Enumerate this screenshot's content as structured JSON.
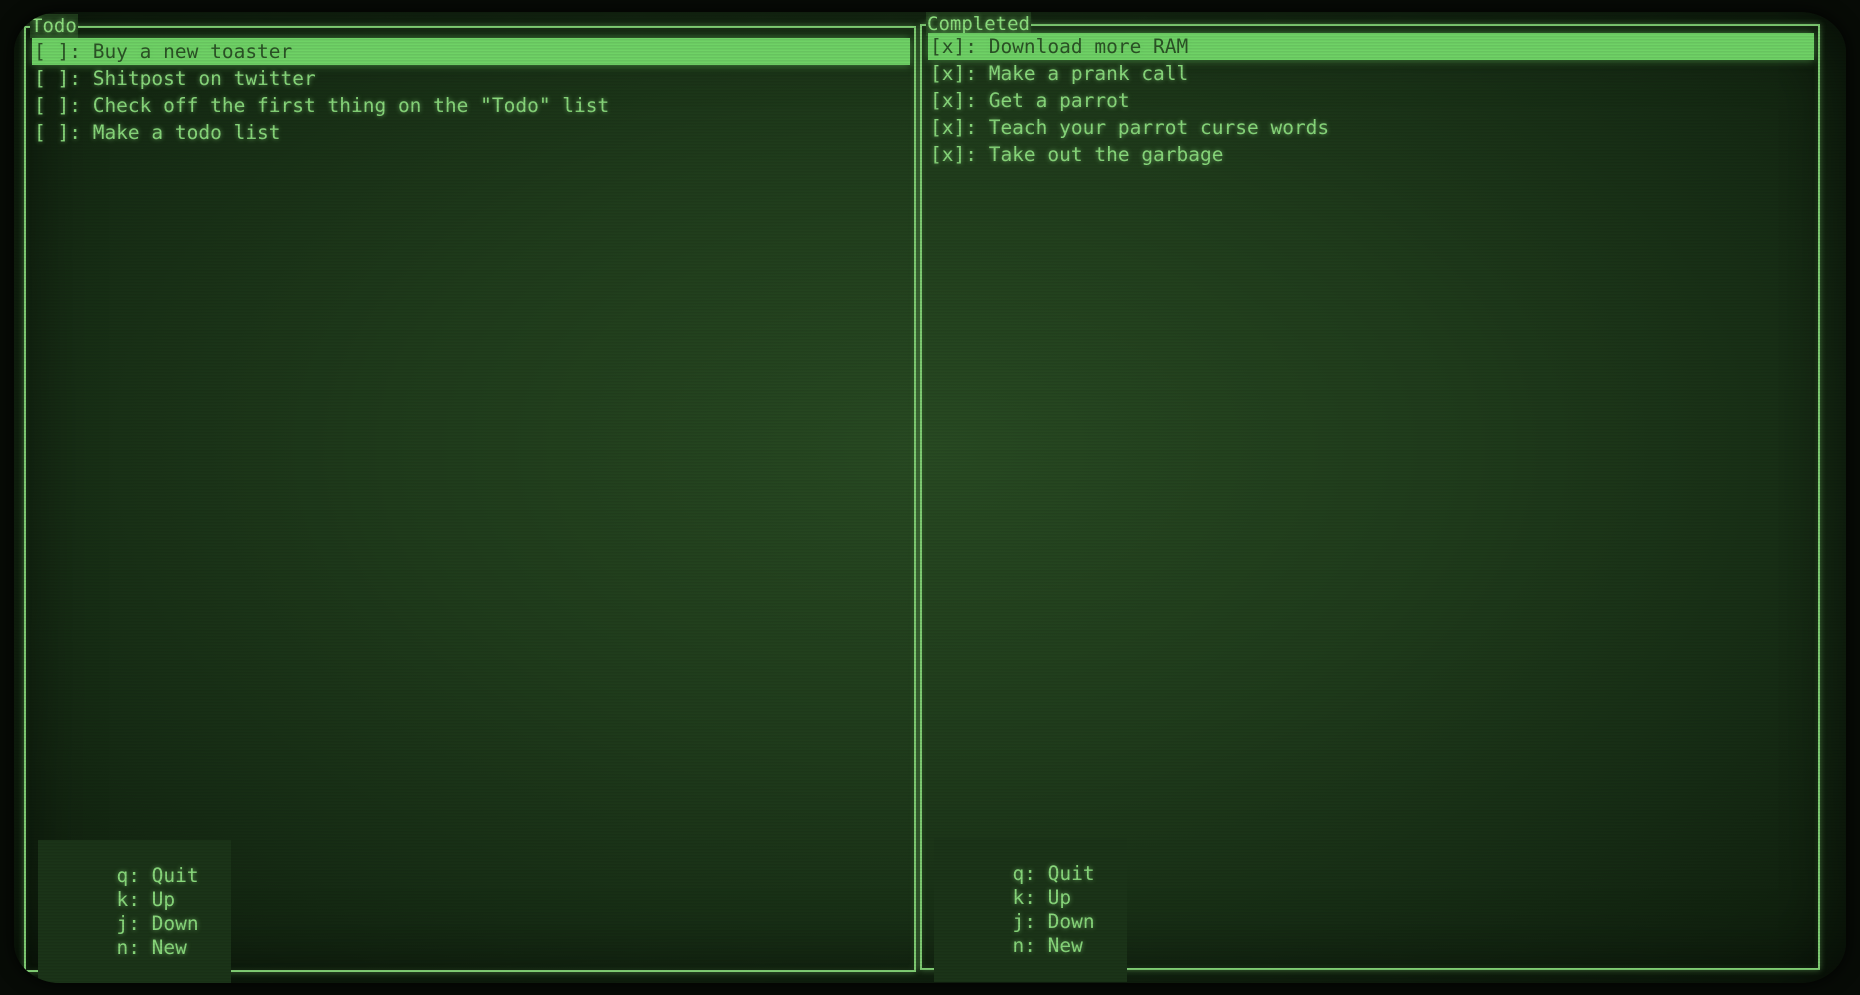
{
  "colors": {
    "background": "#1f3b1b",
    "foreground": "#88d87b",
    "highlight": "#6fd266",
    "highlight_text": "#2b5326"
  },
  "todo": {
    "title": "Todo",
    "items": [
      {
        "text": "[ ]: Buy a new toaster",
        "selected": true
      },
      {
        "text": "[ ]: Shitpost on twitter",
        "selected": false
      },
      {
        "text": "[ ]: Check off the first thing on the \"Todo\" list",
        "selected": false
      },
      {
        "text": "[ ]: Make a todo list",
        "selected": false
      }
    ],
    "footer": {
      "quit": "q: Quit",
      "up": "k: Up",
      "down": "j: Down",
      "new": "n: New"
    }
  },
  "completed": {
    "title": "Completed",
    "items": [
      {
        "text": "[x]: Download more RAM",
        "selected": true
      },
      {
        "text": "[x]: Make a prank call",
        "selected": false
      },
      {
        "text": "[x]: Get a parrot",
        "selected": false
      },
      {
        "text": "[x]: Teach your parrot curse words",
        "selected": false
      },
      {
        "text": "[x]: Take out the garbage",
        "selected": false
      }
    ],
    "footer": {
      "quit": "q: Quit",
      "up": "k: Up",
      "down": "j: Down",
      "new": "n: New"
    }
  }
}
